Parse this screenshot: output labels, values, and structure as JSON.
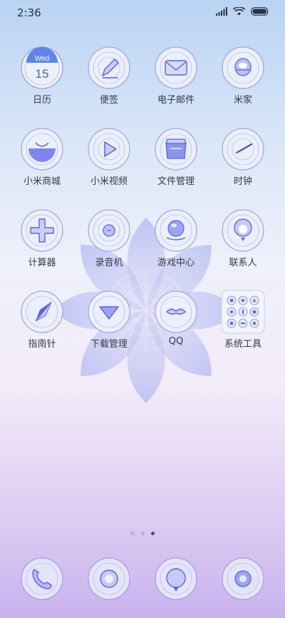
{
  "status_bar": {
    "time": "2:36"
  },
  "calendar_icon": {
    "weekday": "Wed",
    "day": "15"
  },
  "apps": [
    {
      "label": "日历",
      "icon": "calendar-icon"
    },
    {
      "label": "便签",
      "icon": "notes-icon"
    },
    {
      "label": "电子邮件",
      "icon": "email-icon"
    },
    {
      "label": "米家",
      "icon": "mi-home-icon"
    },
    {
      "label": "小米商城",
      "icon": "mi-store-icon"
    },
    {
      "label": "小米视频",
      "icon": "video-icon"
    },
    {
      "label": "文件管理",
      "icon": "file-manager-icon"
    },
    {
      "label": "时钟",
      "icon": "clock-icon"
    },
    {
      "label": "计算器",
      "icon": "calculator-icon"
    },
    {
      "label": "录音机",
      "icon": "recorder-icon"
    },
    {
      "label": "游戏中心",
      "icon": "game-center-icon"
    },
    {
      "label": "联系人",
      "icon": "contacts-icon"
    },
    {
      "label": "指南针",
      "icon": "compass-icon"
    },
    {
      "label": "下载管理",
      "icon": "download-icon"
    },
    {
      "label": "QQ",
      "icon": "qq-icon"
    },
    {
      "label": "系统工具",
      "icon": "system-tools-folder-icon"
    }
  ],
  "dock": [
    {
      "icon": "phone-icon"
    },
    {
      "icon": "messages-icon"
    },
    {
      "icon": "browser-icon"
    },
    {
      "icon": "camera-icon"
    }
  ],
  "page_indicator": {
    "pages": 3,
    "active_index": 2
  },
  "colors": {
    "accent": "#5b63e6",
    "label": "#333a4a"
  }
}
